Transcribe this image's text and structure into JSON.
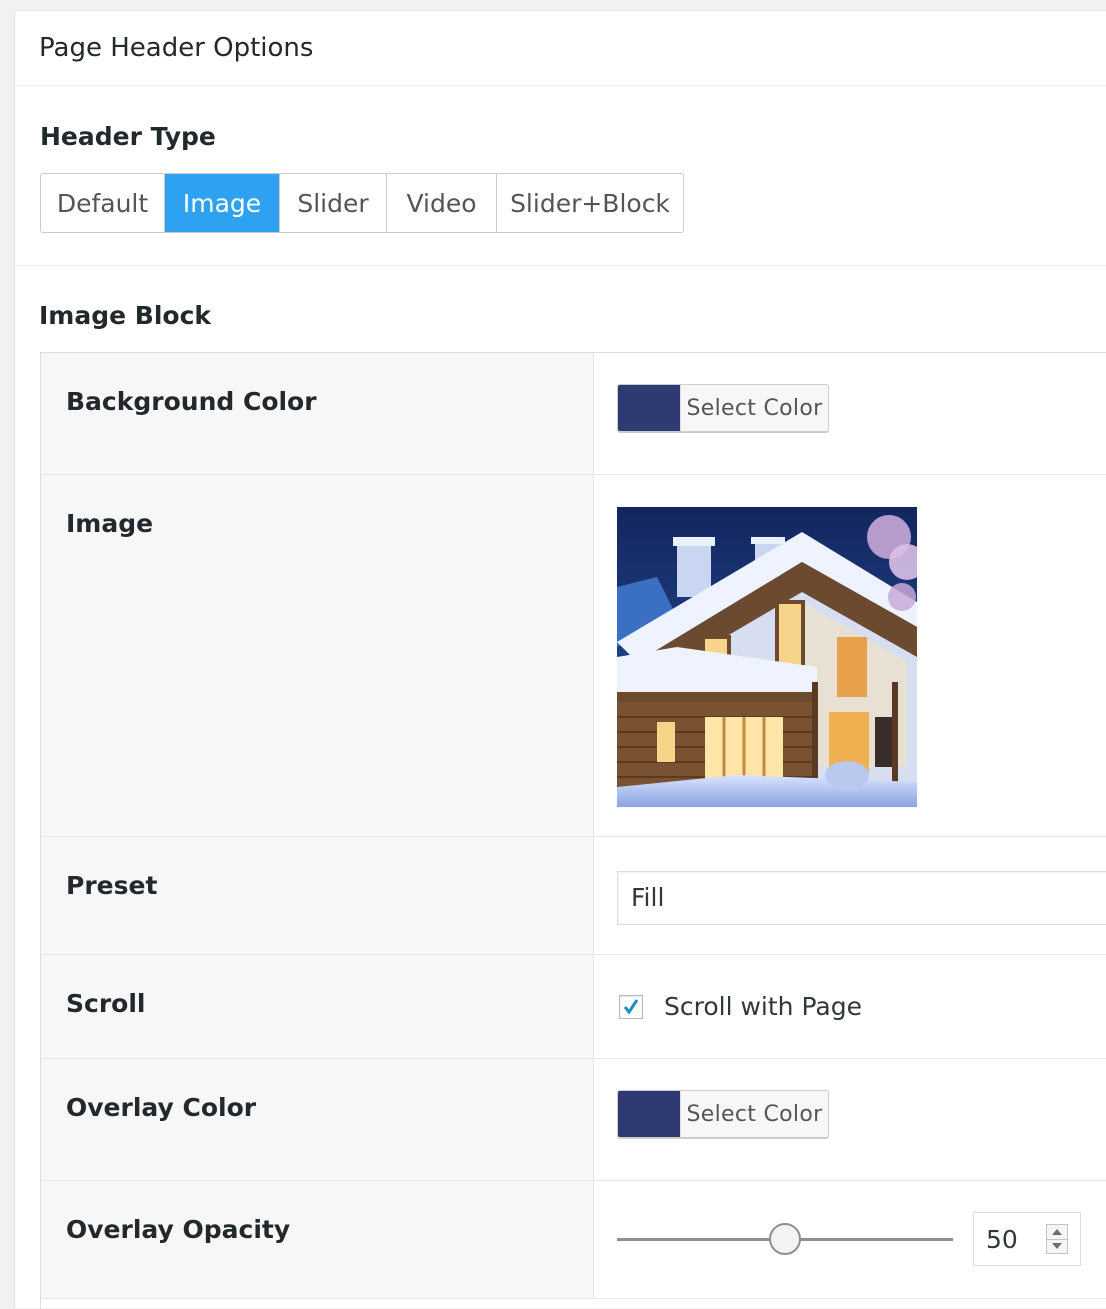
{
  "panel": {
    "title": "Page Header Options"
  },
  "header_type": {
    "label": "Header Type",
    "tabs": [
      {
        "label": "Default",
        "active": false
      },
      {
        "label": "Image",
        "active": true
      },
      {
        "label": "Slider",
        "active": false
      },
      {
        "label": "Video",
        "active": false
      },
      {
        "label": "Slider+Block",
        "active": false
      }
    ],
    "active_color": "#2ea2f0"
  },
  "image_block": {
    "label": "Image Block",
    "background_color": {
      "label": "Background Color",
      "button_label": "Select Color",
      "swatch": "#2f3a72"
    },
    "image": {
      "label": "Image",
      "alt": "snow-covered chalet at dusk"
    },
    "preset": {
      "label": "Preset",
      "value": "Fill"
    },
    "scroll": {
      "label": "Scroll",
      "checkbox_label": "Scroll with Page",
      "checked": true
    },
    "overlay_color": {
      "label": "Overlay Color",
      "button_label": "Select Color",
      "swatch": "#2f3a72"
    },
    "overlay_opacity": {
      "label": "Overlay Opacity",
      "value": "50",
      "min": 0,
      "max": 100
    }
  }
}
